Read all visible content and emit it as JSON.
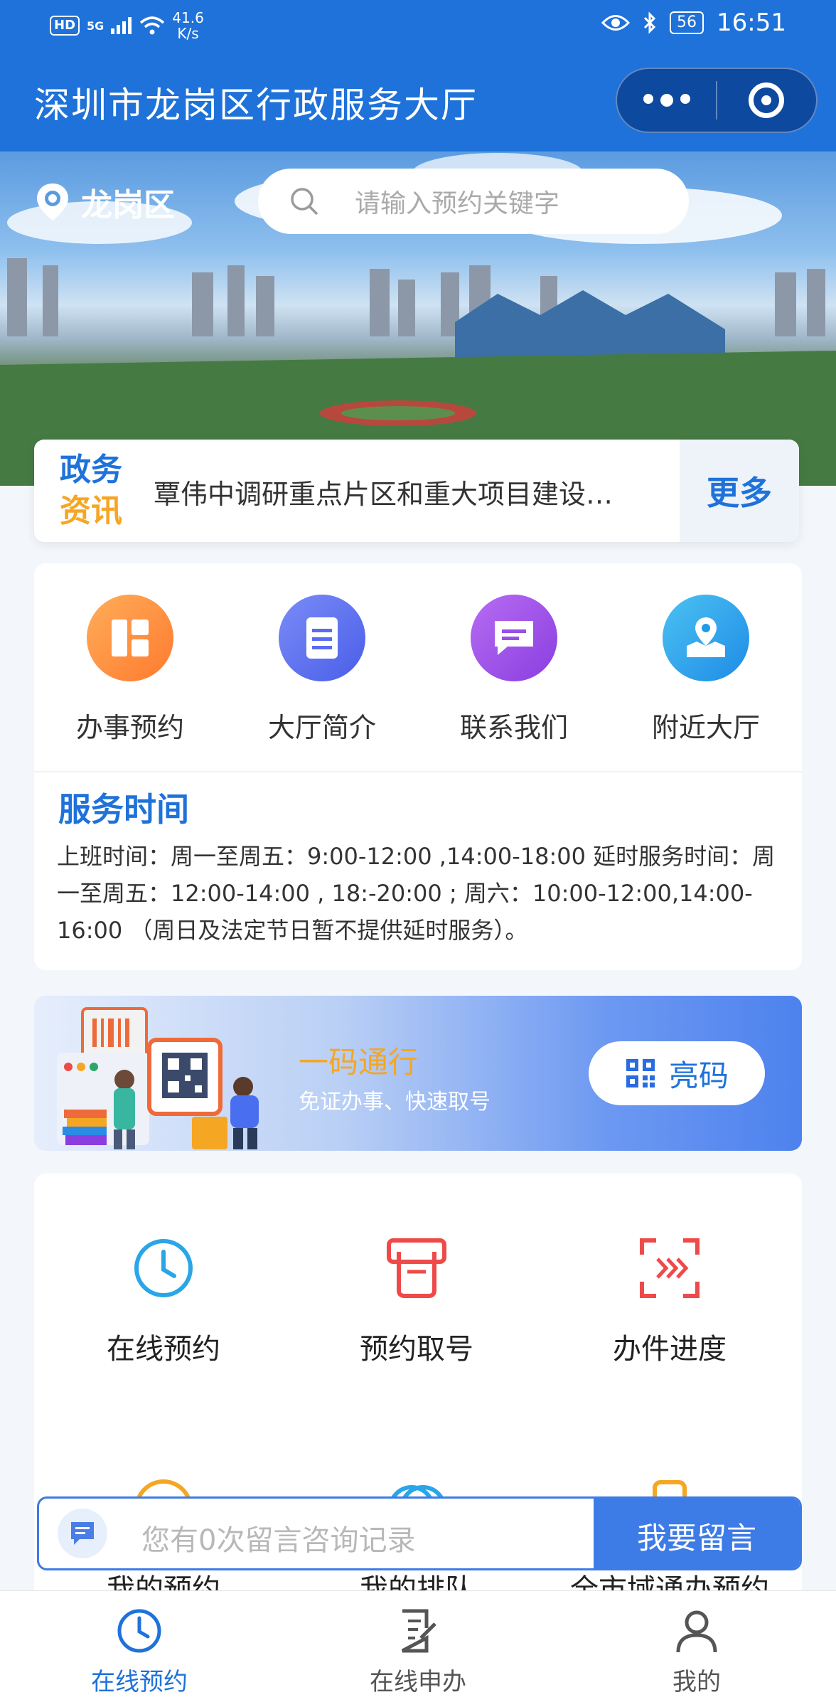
{
  "status_bar": {
    "hd": "HD",
    "signal": "5G",
    "net_speed": "41.6",
    "net_unit": "K/s",
    "battery": "56",
    "time": "16:51"
  },
  "header": {
    "title": "深圳市龙岗区行政服务大厅"
  },
  "banner": {
    "location": "龙岗区",
    "search_placeholder": "请输入预约关键字"
  },
  "news": {
    "tag_line1": "政务",
    "tag_line2": "资讯",
    "headline": "覃伟中调研重点片区和重大项目建设…",
    "more": "更多"
  },
  "quick_menu": [
    {
      "label": "办事预约",
      "icon": "grid-icon",
      "color": "#ff8c3a"
    },
    {
      "label": "大厅简介",
      "icon": "document-icon",
      "color": "#5a6cf0"
    },
    {
      "label": "联系我们",
      "icon": "chat-icon",
      "color": "#9b4de8"
    },
    {
      "label": "附近大厅",
      "icon": "map-pin-icon",
      "color": "#1e9be8"
    }
  ],
  "service_time": {
    "title": "服务时间",
    "line1": "上班时间：周一至周五：9:00-12:00 ,14:00-18:00 延时服务时间：周",
    "line2": "一至周五：12:00-14:00 , 18:-20:00 ; 周六：10:00-12:00,14:00-",
    "line3": "16:00 （周日及法定节日暂不提供延时服务）。"
  },
  "code_pass": {
    "title": "一码通行",
    "subtitle": "免证办事、快速取号",
    "button": "亮码"
  },
  "services": [
    {
      "label": "在线预约",
      "icon": "clock-icon",
      "color": "#2aa6e8"
    },
    {
      "label": "预约取号",
      "icon": "ticket-icon",
      "color": "#ee4a4a"
    },
    {
      "label": "办件进度",
      "icon": "progress-icon",
      "color": "#ee4a4a"
    },
    {
      "label": "我的预约",
      "icon": "calendar-icon",
      "color": "#f5a623"
    },
    {
      "label": "我的排队",
      "icon": "queue-icon",
      "color": "#2aa6e8"
    },
    {
      "label": "全市域通办预约",
      "icon": "city-icon",
      "color": "#f5a623"
    }
  ],
  "message_bar": {
    "placeholder": "您有0次留言咨询记录",
    "button": "我要留言"
  },
  "tabbar": [
    {
      "label": "在线预约",
      "icon": "clock-icon",
      "active": true
    },
    {
      "label": "在线申办",
      "icon": "edit-doc-icon",
      "active": false
    },
    {
      "label": "我的",
      "icon": "user-icon",
      "active": false
    }
  ],
  "colors": {
    "primary": "#1e72d9",
    "accent": "#f5a623",
    "tab_active": "#1e72d9",
    "tab_inactive": "#555555"
  }
}
